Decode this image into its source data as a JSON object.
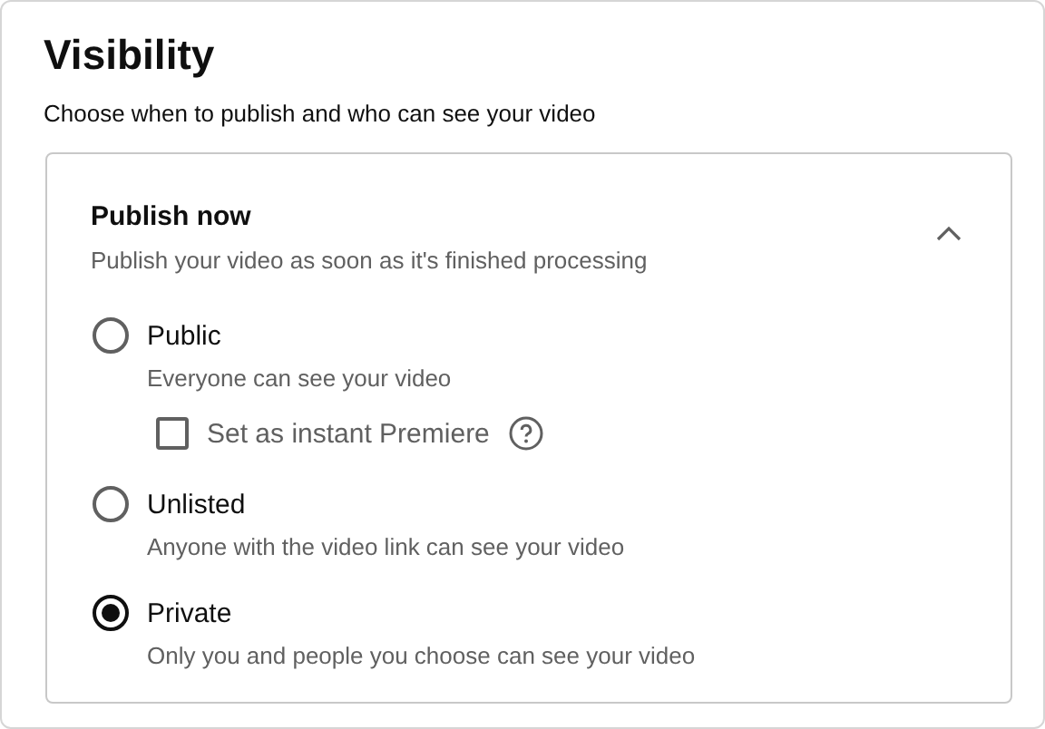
{
  "title": "Visibility",
  "subtitle": "Choose when to publish and who can see your video",
  "section": {
    "heading": "Publish now",
    "description": "Publish your video as soon as it's finished processing",
    "expanded": true,
    "options": [
      {
        "label": "Public",
        "description": "Everyone can see your video",
        "selected": false,
        "premiere": {
          "label": "Set as instant Premiere",
          "checked": false
        }
      },
      {
        "label": "Unlisted",
        "description": "Anyone with the video link can see your video",
        "selected": false
      },
      {
        "label": "Private",
        "description": "Only you and people you choose can see your video",
        "selected": true
      }
    ]
  }
}
